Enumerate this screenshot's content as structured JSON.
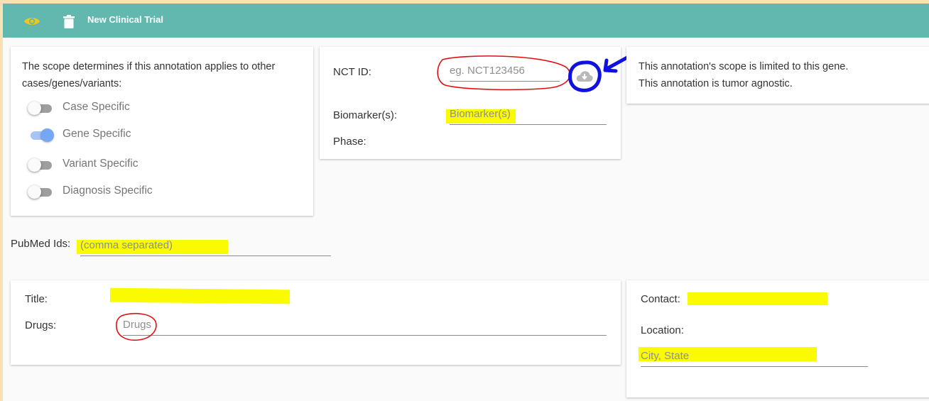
{
  "toolbar": {
    "title": "New Clinical Trial",
    "view_icon": "eye-icon",
    "delete_icon": "trash-icon"
  },
  "scope": {
    "description": "The scope determines if this annotation applies to other cases/genes/variants:",
    "toggles": [
      {
        "label": "Case Specific",
        "on": false
      },
      {
        "label": "Gene Specific",
        "on": true
      },
      {
        "label": "Variant Specific",
        "on": false
      },
      {
        "label": "Diagnosis Specific",
        "on": false
      }
    ]
  },
  "trial": {
    "nct_label": "NCT ID:",
    "nct_placeholder": "eg. NCT123456",
    "fetch_icon": "cloud-download-icon",
    "biomarker_label": "Biomarker(s):",
    "biomarker_placeholder": "Biomarker(s)",
    "phase_label": "Phase:"
  },
  "scope_summary": {
    "line1": "This annotation's scope is limited to this gene.",
    "line2": "This annotation is tumor agnostic."
  },
  "pubmed": {
    "label": "PubMed Ids:",
    "placeholder": "(comma separated)"
  },
  "details": {
    "title_label": "Title:",
    "drugs_label": "Drugs:",
    "drugs_placeholder": "Drugs"
  },
  "contact": {
    "contact_label": "Contact:",
    "location_label": "Location:",
    "location_placeholder": "City, State"
  },
  "colors": {
    "toolbar": "#62b8ae",
    "eye_icon": "#f5c518",
    "highlight": "#fbfb00",
    "toggle_on": "#75a7f5",
    "red_annotation": "#e01010",
    "blue_annotation": "#1010e0"
  }
}
